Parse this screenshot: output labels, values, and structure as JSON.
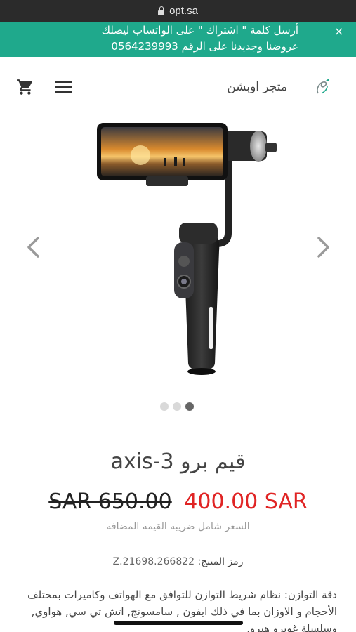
{
  "browser": {
    "url": "opt.sa"
  },
  "promo": {
    "line1": "أرسل كلمة \" اشتراك \" على الواتساب ليصلك",
    "line2": "عروضنا وجديدنا على الرقم 0564239993",
    "close": "×"
  },
  "header": {
    "store_name": "متجر اوبشن"
  },
  "gallery": {
    "slides": 3,
    "active_slide": 3
  },
  "product": {
    "title": "قيم برو axis-3",
    "old_price": "SAR 650.00",
    "new_price": "400.00 SAR",
    "vat_note": "السعر شامل ضريبة القيمة المضافة",
    "sku_label": "رمز المنتج:",
    "sku_value": "Z.21698.266822",
    "description": "دقة التوازن: نظام شريط التوازن للتوافق مع الهواتف وكاميرات بمختلف الأحجام و الاوزان بما في ذلك ايفون , سامسونج, اتش تي سي, هواوي, وسلسلة غوبرو هيرو."
  },
  "colors": {
    "brand": "#1fa98c",
    "sale": "#e02424"
  }
}
